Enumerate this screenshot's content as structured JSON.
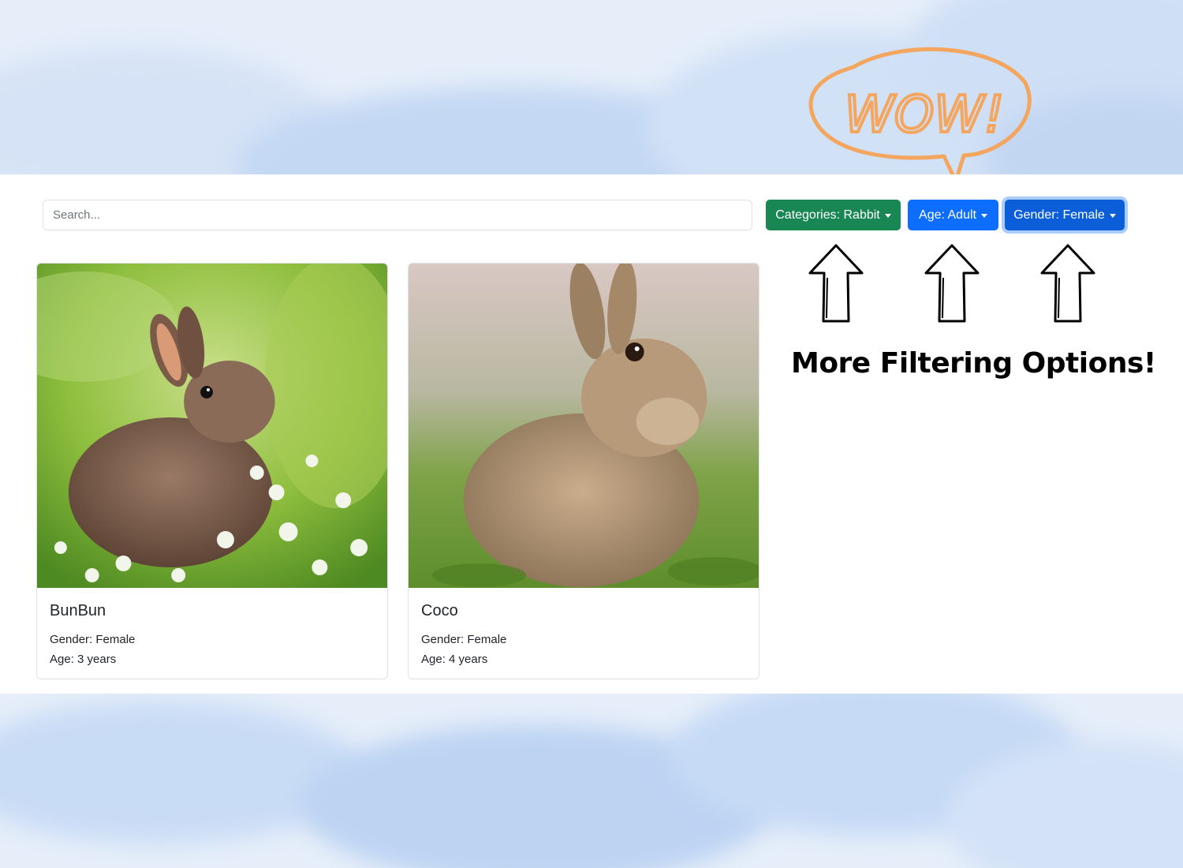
{
  "search": {
    "placeholder": "Search..."
  },
  "filters": {
    "category_label": "Categories: Rabbit",
    "age_label": "Age: Adult",
    "gender_label": "Gender: Female"
  },
  "pets": [
    {
      "name": "BunBun",
      "gender": "Gender: Female",
      "age": "Age: 3 years"
    },
    {
      "name": "Coco",
      "gender": "Gender: Female",
      "age": "Age: 4 years"
    }
  ],
  "annotation": {
    "wow_text": "WOW!",
    "promo_text": "More Filtering Options!"
  },
  "colors": {
    "category_button": "#198754",
    "age_button": "#0d6efd",
    "gender_button": "#0b5ed7",
    "wow_stroke": "#f4a55e",
    "background": "#e6eefa"
  },
  "icons": [
    "up-arrow-icon",
    "speech-bubble-icon",
    "caret-down-icon"
  ]
}
